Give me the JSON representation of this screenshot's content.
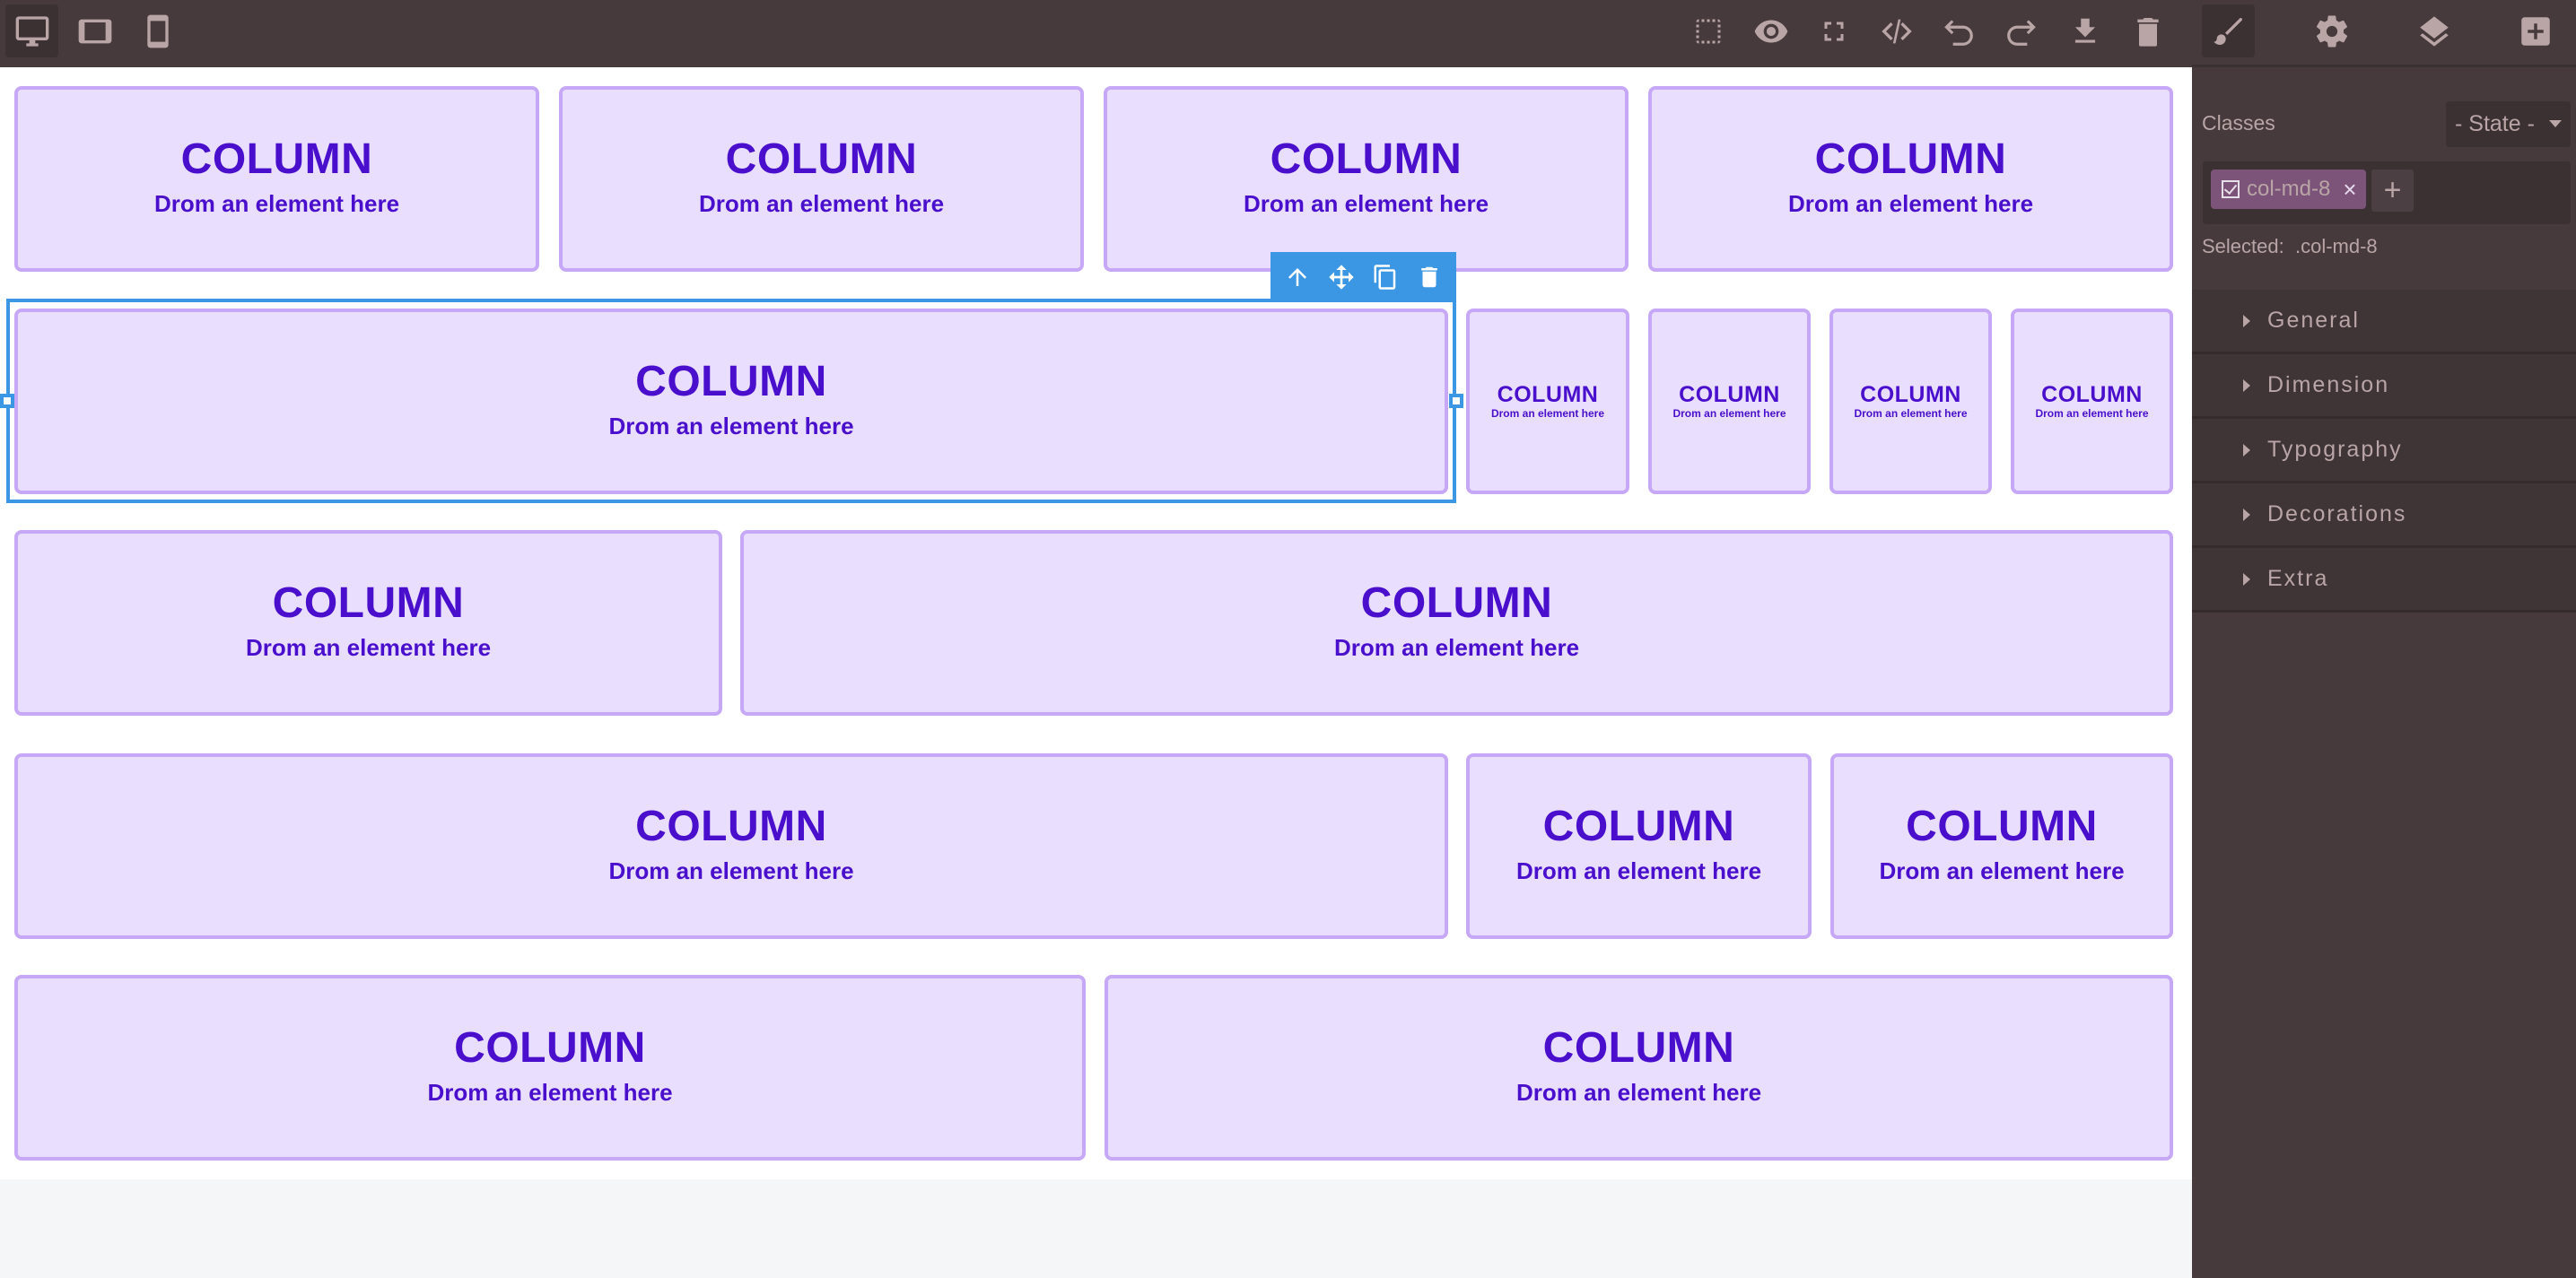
{
  "topbar": {
    "devices": [
      {
        "name": "desktop",
        "icon": "desktop-icon",
        "active": true
      },
      {
        "name": "tablet",
        "icon": "tablet-icon",
        "active": false
      },
      {
        "name": "mobile",
        "icon": "mobile-icon",
        "active": false
      }
    ],
    "actions": [
      {
        "name": "show-borders",
        "icon": "dashed-square-icon"
      },
      {
        "name": "preview",
        "icon": "eye-icon"
      },
      {
        "name": "fullscreen",
        "icon": "fullscreen-icon"
      },
      {
        "name": "view-code",
        "icon": "code-icon"
      },
      {
        "name": "undo",
        "icon": "undo-icon"
      },
      {
        "name": "redo",
        "icon": "redo-icon"
      },
      {
        "name": "export",
        "icon": "download-icon"
      },
      {
        "name": "clear-canvas",
        "icon": "trash-icon"
      }
    ]
  },
  "panel": {
    "tabs": [
      {
        "name": "style-manager",
        "icon": "paint-brush-icon",
        "active": true
      },
      {
        "name": "settings",
        "icon": "gear-icon",
        "active": false
      },
      {
        "name": "layer-manager",
        "icon": "layers-icon",
        "active": false
      },
      {
        "name": "blocks",
        "icon": "plus-square-icon",
        "active": false
      }
    ],
    "classes_label": "Classes",
    "state_select": "- State -",
    "tags": [
      {
        "name": "col-md-8",
        "checked": true,
        "remove": "×"
      }
    ],
    "add_tag": "+",
    "selected_label": "Selected:",
    "selected_value": ".col-md-8",
    "sectors": [
      "General",
      "Dimension",
      "Typography",
      "Decorations",
      "Extra"
    ]
  },
  "canvas": {
    "column_title": "COLUMN",
    "column_subtitle": "Drom an element here",
    "selected_toolbar": [
      {
        "name": "select-parent",
        "icon": "arrow-up-icon"
      },
      {
        "name": "move",
        "icon": "move-icon"
      },
      {
        "name": "clone",
        "icon": "copy-icon"
      },
      {
        "name": "delete",
        "icon": "trash-icon"
      }
    ],
    "rows": [
      {
        "columns": [
          "col-md-3",
          "col-md-3",
          "col-md-3",
          "col-md-3"
        ]
      },
      {
        "columns": [
          "col-md-8",
          "col-md-1",
          "col-md-1",
          "col-md-1",
          "col-md-1"
        ],
        "selected_index": 0
      },
      {
        "columns": [
          "col-md-4",
          "col-md-8"
        ]
      },
      {
        "columns": [
          "col-md-8",
          "col-md-2",
          "col-md-2"
        ]
      },
      {
        "columns": [
          "col-md-6",
          "col-md-6"
        ]
      }
    ]
  }
}
